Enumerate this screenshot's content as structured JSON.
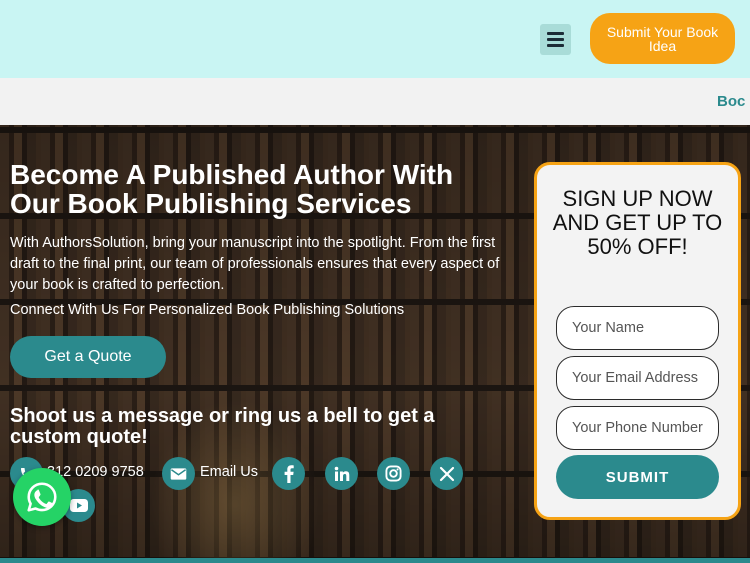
{
  "header": {
    "menu_icon": "hamburger-menu-icon",
    "cta_label": "Submit Your Book Idea",
    "accent_color": "#f6a315",
    "bg_color": "#c9f5f3"
  },
  "ticker": {
    "text": "Boc"
  },
  "hero": {
    "headline": "Become A Published Author With Our Book Publishing Services",
    "intro": "With AuthorsSolution, bring your manuscript into the spotlight. From the first draft to the final print, our team of professionals ensures that every aspect of your book is crafted to perfection.",
    "connect": "Connect With Us For Personalized Book Publishing Solutions",
    "quote_button": "Get a Quote",
    "shoot_message": "Shoot us a message or ring us a bell to get a custom quote!",
    "phone": "312 0209 9758",
    "email_label": "Email Us",
    "socials": [
      "facebook-icon",
      "linkedin-icon",
      "instagram-icon",
      "x-icon",
      "youtube-icon"
    ],
    "brand_color": "#2b8a8d"
  },
  "form": {
    "title": "SIGN UP NOW AND GET UP TO 50% OFF!",
    "name_placeholder": "Your Name",
    "email_placeholder": "Your Email Address",
    "phone_placeholder": "Your Phone Number",
    "submit_label": "SUBMIT"
  },
  "whatsapp": {
    "icon": "whatsapp-icon",
    "color": "#25d366"
  }
}
